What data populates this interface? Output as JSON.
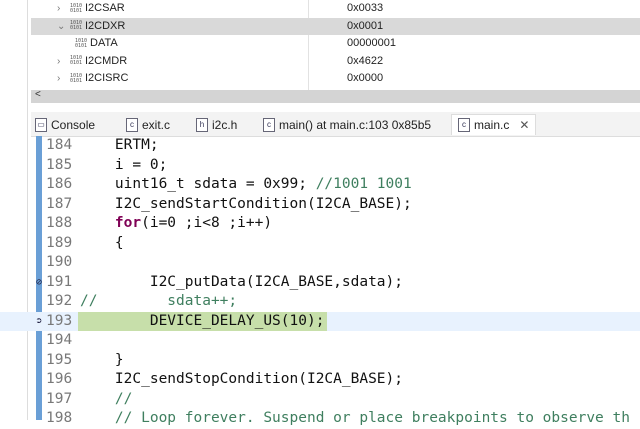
{
  "registers": [
    {
      "name": "I2CSAR",
      "value": "0x0033",
      "expanded": false
    },
    {
      "name": "I2CDXR",
      "value": "0x0001",
      "expanded": true,
      "selected": true
    },
    {
      "name": "DATA",
      "value": "00000001",
      "child": true
    },
    {
      "name": "I2CMDR",
      "value": "0x4622",
      "expanded": false
    },
    {
      "name": "I2CISRC",
      "value": "0x0000",
      "expanded": false
    }
  ],
  "scroll_left": "<",
  "tabs": [
    {
      "label": "Console",
      "icon": "console-icon"
    },
    {
      "label": "exit.c",
      "icon": "c-file-icon"
    },
    {
      "label": "i2c.h",
      "icon": "h-file-icon"
    },
    {
      "label": "main() at main.c:103 0x85b5",
      "icon": "c-file-icon"
    },
    {
      "label": "main.c",
      "icon": "c-file-icon",
      "active": true,
      "close": "✕"
    }
  ],
  "code": [
    {
      "n": "184",
      "t": "    ERTM;"
    },
    {
      "n": "185",
      "t": "    i = 0;"
    },
    {
      "n": "186",
      "t": "    uint16_t sdata = 0x99; ",
      "c": "//1001 1001"
    },
    {
      "n": "187",
      "t": "    I2C_sendStartCondition(I2CA_BASE);"
    },
    {
      "n": "188",
      "k": "    for",
      "t": "(i=0 ;i<8 ;i++)"
    },
    {
      "n": "189",
      "t": "    {"
    },
    {
      "n": "190",
      "t": ""
    },
    {
      "n": "191",
      "t": "        I2C_putData(I2CA_BASE,sdata);"
    },
    {
      "n": "192",
      "c": "//        sdata++;"
    },
    {
      "n": "193",
      "t": "        DEVICE_DELAY_US(10);",
      "current": true
    },
    {
      "n": "194",
      "t": ""
    },
    {
      "n": "195",
      "t": "    }"
    },
    {
      "n": "196",
      "t": "    I2C_sendStopCondition(I2CA_BASE);"
    },
    {
      "n": "197",
      "c": "    //"
    },
    {
      "n": "198",
      "c": "    // Loop forever. Suspend or place breakpoints to observe th"
    }
  ]
}
